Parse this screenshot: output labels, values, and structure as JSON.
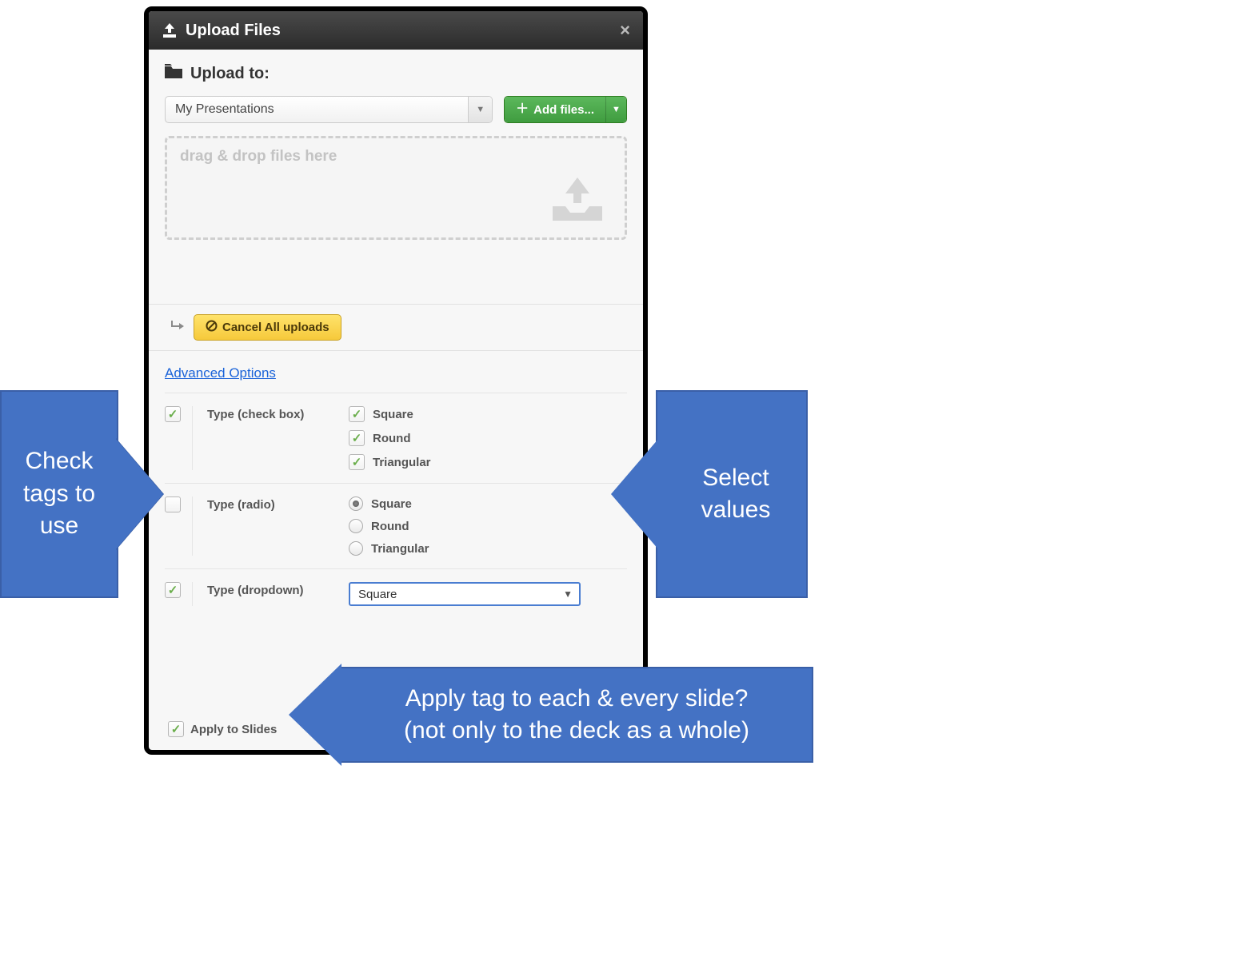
{
  "dialog": {
    "title": "Upload Files",
    "upload_to_label": "Upload to:",
    "folder_selected": "My Presentations",
    "add_files_label": "Add files...",
    "dropzone_text": "drag & drop files here",
    "cancel_label": "Cancel All uploads",
    "advanced_link": "Advanced Options",
    "sections": {
      "checkbox": {
        "enabled": true,
        "label": "Type (check box)",
        "values": [
          {
            "label": "Square",
            "checked": true
          },
          {
            "label": "Round",
            "checked": true
          },
          {
            "label": "Triangular",
            "checked": true
          }
        ]
      },
      "radio": {
        "enabled": false,
        "label": "Type (radio)",
        "values": [
          {
            "label": "Square",
            "selected": true
          },
          {
            "label": "Round",
            "selected": false
          },
          {
            "label": "Triangular",
            "selected": false
          }
        ]
      },
      "dropdown": {
        "enabled": true,
        "label": "Type (dropdown)",
        "selected": "Square"
      }
    },
    "apply_to_slides_label": "Apply to Slides",
    "apply_to_slides_checked": true
  },
  "annotations": {
    "left": "Check tags to use",
    "right": "Select values",
    "bottom_line1": "Apply tag to each & every slide?",
    "bottom_line2": "(not only to the deck as a whole)"
  }
}
